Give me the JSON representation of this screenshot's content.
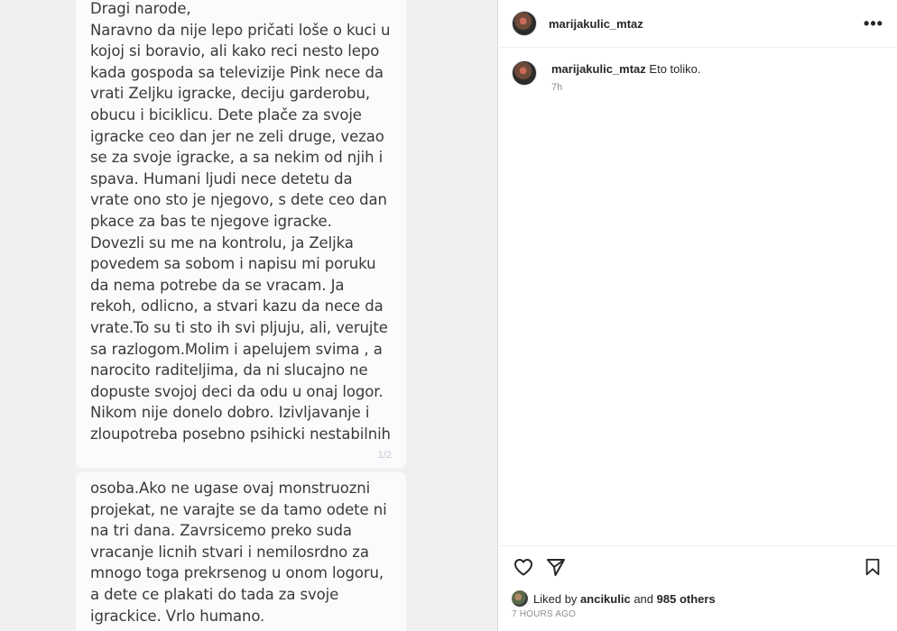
{
  "post": {
    "image_text_1": "Dragi narode,\nNaravno da nije lepo pričati loše o kuci u kojoj si boravio, ali kako reci nesto lepo kada gospoda sa televizije Pink nece da vrati Zeljku igracke, deciju garderobu, obucu i biciklicu. Dete plače za svoje igracke ceo dan jer ne zeli druge, vezao se za svoje igracke, a sa nekim od njih i spava. Humani ljudi nece detetu da vrate ono sto je njegovo, s dete ceo dan pkace za bas te njegove igracke.\nDovezli su me na kontrolu, ja Zeljka povedem sa sobom i napisu mi poruku da nema potrebe da se vracam. Ja rekoh, odlicno, a stvari kazu da nece da vrate.To su ti sto ih svi pljuju, ali, verujte sa razlogom.Molim i apelujem svima , a narocito raditeljima, da ni slucajno ne dopuste svojoj deci da odu u onaj logor. Nikom nije donelo dobro. Izivljavanje i zloupotreba posebno psihicki nestabilnih",
    "page_counter": "1/2",
    "image_text_2": "osoba.Ako ne ugase ovaj monstruozni projekat, ne varajte se da tamo odete ni na tri dana. Zavrsicemo preko suda vracanje licnih stvari i nemilosrdno za mnogo toga prekrsenog u onom logoru, a dete ce plakati do tada za svoje igrackice. Vrlo humano."
  },
  "header": {
    "username": "marijakulic_mtaz",
    "more_label": "•••"
  },
  "comment": {
    "username": "marijakulic_mtaz",
    "text": "Eto toliko.",
    "time": "7h"
  },
  "likes": {
    "prefix": "Liked by",
    "user": "ancikulic",
    "and": "and",
    "others": "985 others"
  },
  "date": "7 HOURS AGO",
  "icons": {
    "like": "heart-icon",
    "share": "paper-plane-icon",
    "save": "bookmark-icon"
  }
}
